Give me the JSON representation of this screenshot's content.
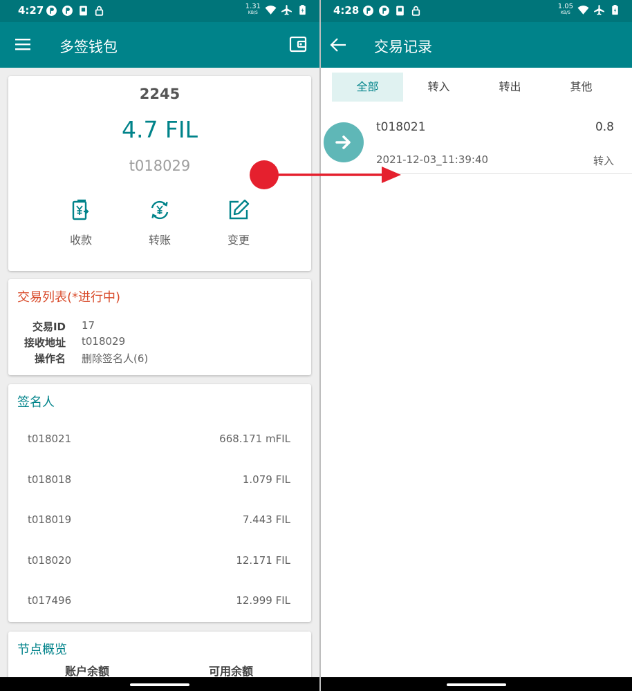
{
  "left": {
    "status": {
      "time": "4:27",
      "net_speed": "1.31",
      "net_unit": "KB/S"
    },
    "toolbar": {
      "title": "多签钱包"
    },
    "wallet": {
      "name": "2245",
      "balance": "4.7 FIL",
      "address": "t018029"
    },
    "actions": [
      {
        "label": "收款",
        "icon": "receive-icon"
      },
      {
        "label": "转账",
        "icon": "transfer-icon"
      },
      {
        "label": "变更",
        "icon": "edit-icon"
      }
    ],
    "transactions": {
      "title": "交易列表(*进行中)",
      "rows": [
        {
          "key": "交易ID",
          "value": "17"
        },
        {
          "key": "接收地址",
          "value": "t018029"
        },
        {
          "key": "操作名",
          "value": "删除签名人(6)"
        }
      ]
    },
    "signers": {
      "title": "签名人",
      "items": [
        {
          "address": "t018021",
          "amount": "668.171 mFIL"
        },
        {
          "address": "t018018",
          "amount": "1.079 FIL"
        },
        {
          "address": "t018019",
          "amount": "7.443 FIL"
        },
        {
          "address": "t018020",
          "amount": "12.171 FIL"
        },
        {
          "address": "t017496",
          "amount": "12.999 FIL"
        }
      ]
    },
    "node": {
      "title": "节点概览",
      "col1": "账户余额",
      "col2": "可用余额"
    }
  },
  "right": {
    "status": {
      "time": "4:28",
      "net_speed": "1.05",
      "net_unit": "KB/S"
    },
    "toolbar": {
      "title": "交易记录"
    },
    "tabs": [
      {
        "label": "全部",
        "active": true
      },
      {
        "label": "转入",
        "active": false
      },
      {
        "label": "转出",
        "active": false
      },
      {
        "label": "其他",
        "active": false
      }
    ],
    "records": [
      {
        "address": "t018021",
        "amount": "0.8",
        "time": "2021-12-03_11:39:40",
        "type": "转入"
      }
    ]
  },
  "colors": {
    "primary": "#00838a",
    "status_bar": "#00757a",
    "accent_red": "#e5202e",
    "section_red": "#d84a2a"
  }
}
